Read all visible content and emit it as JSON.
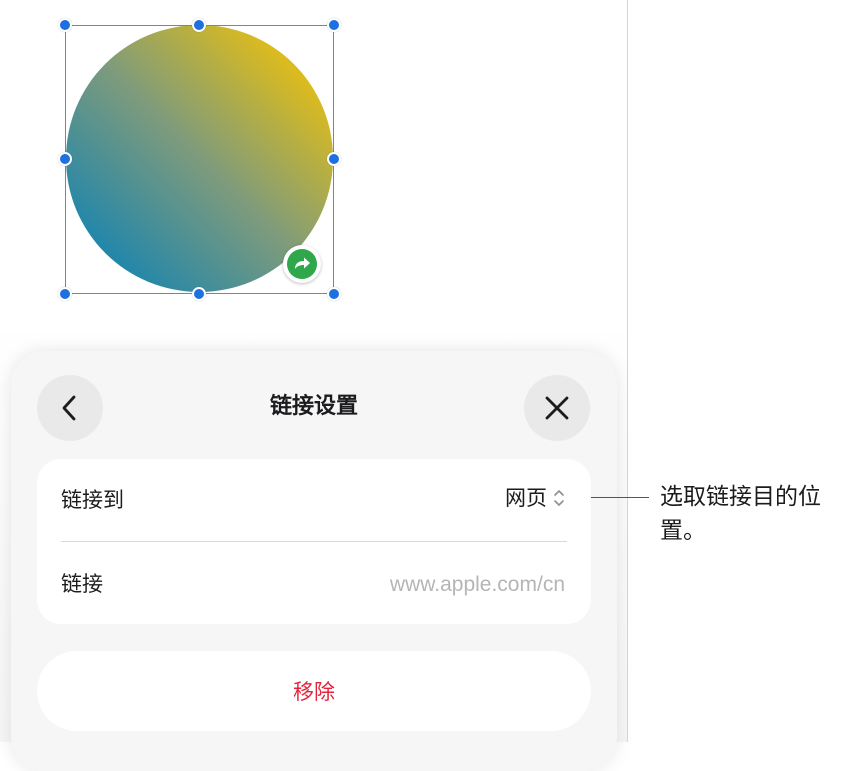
{
  "panel": {
    "title": "链接设置",
    "back_icon": "chevron-left-icon",
    "close_icon": "close-icon",
    "rows": {
      "link_to": {
        "label": "链接到",
        "value": "网页",
        "icon": "up-down-chevron-icon"
      },
      "link": {
        "label": "链接",
        "placeholder": "www.apple.com/cn",
        "value": ""
      }
    },
    "remove_label": "移除"
  },
  "callout": {
    "text": "选取链接目的位置。"
  },
  "shape": {
    "type": "circle",
    "gradient_colors": [
      "#1584b0",
      "#7e9b7c",
      "#f0c20a"
    ],
    "link_badge_icon": "link-arrow-icon",
    "link_badge_color": "#2ea84a"
  },
  "colors": {
    "accent": "#1e6fe0",
    "destructive": "#e5243b"
  }
}
